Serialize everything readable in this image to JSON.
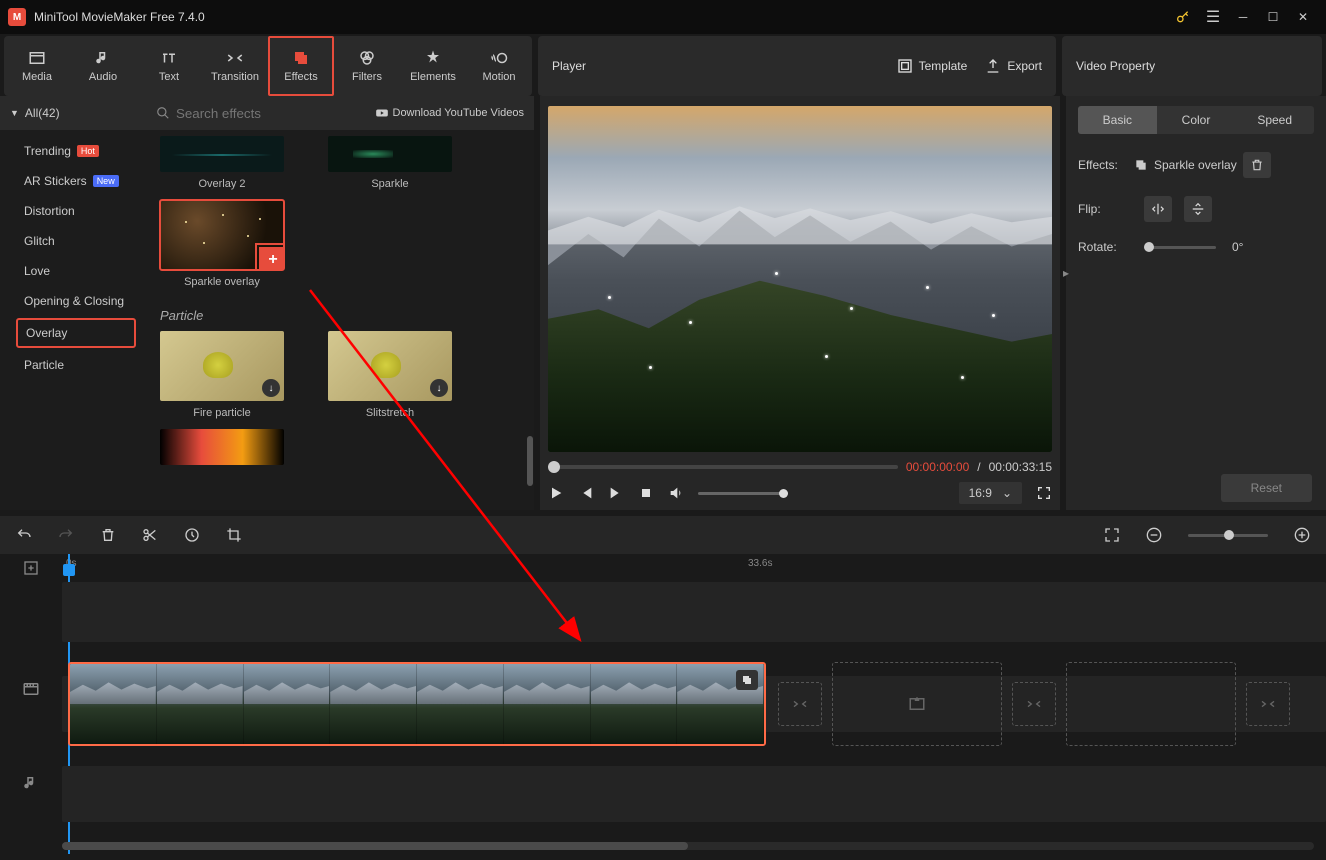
{
  "titlebar": {
    "title": "MiniTool MovieMaker Free 7.4.0"
  },
  "toolbar": {
    "items": [
      {
        "label": "Media"
      },
      {
        "label": "Audio"
      },
      {
        "label": "Text"
      },
      {
        "label": "Transition"
      },
      {
        "label": "Effects"
      },
      {
        "label": "Filters"
      },
      {
        "label": "Elements"
      },
      {
        "label": "Motion"
      }
    ],
    "active_index": 4
  },
  "player_header": {
    "title": "Player",
    "template": "Template",
    "export": "Export"
  },
  "prop_header": {
    "title": "Video Property"
  },
  "sidebar": {
    "all_label": "All(42)",
    "categories": [
      {
        "label": "Trending",
        "badge": "Hot",
        "badge_class": "hot"
      },
      {
        "label": "AR Stickers",
        "badge": "New",
        "badge_class": "new"
      },
      {
        "label": "Distortion"
      },
      {
        "label": "Glitch"
      },
      {
        "label": "Love"
      },
      {
        "label": "Opening & Closing"
      },
      {
        "label": "Overlay",
        "selected": true
      },
      {
        "label": "Particle"
      }
    ]
  },
  "search": {
    "placeholder": "Search effects",
    "download_label": "Download YouTube Videos"
  },
  "effects": {
    "row1": [
      {
        "label": "Overlay 2"
      },
      {
        "label": "Sparkle"
      }
    ],
    "row2": [
      {
        "label": "Sparkle overlay",
        "selected": true,
        "add": true
      }
    ],
    "section2": "Particle",
    "row3": [
      {
        "label": "Fire particle"
      },
      {
        "label": "Slitstretch"
      }
    ]
  },
  "player": {
    "current": "00:00:00:00",
    "sep": " / ",
    "duration": "00:00:33:15",
    "aspect": "16:9"
  },
  "prop": {
    "tabs": [
      "Basic",
      "Color",
      "Speed"
    ],
    "active_tab": 0,
    "effects_label": "Effects:",
    "effect_name": "Sparkle overlay",
    "flip_label": "Flip:",
    "rotate_label": "Rotate:",
    "rotate_value": "0°",
    "reset": "Reset"
  },
  "timeline": {
    "marks": [
      "0s",
      "33.6s"
    ]
  }
}
